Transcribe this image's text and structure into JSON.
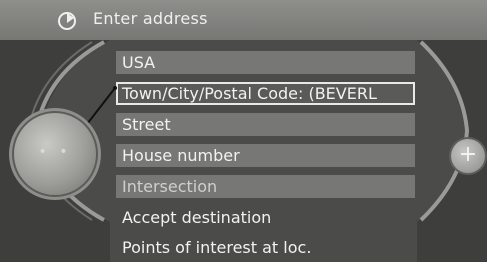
{
  "header": {
    "title": "Enter address",
    "icon": "navigation-flag-icon"
  },
  "menu": {
    "items": [
      {
        "label": "USA",
        "style": "boxed"
      },
      {
        "label": "Town/City/Postal Code: (BEVERL",
        "style": "selected"
      },
      {
        "label": "Street",
        "style": "boxed"
      },
      {
        "label": "House number",
        "style": "boxed"
      },
      {
        "label": "Intersection",
        "style": "boxed"
      },
      {
        "label": "Accept destination",
        "style": "plain"
      },
      {
        "label": "Points of interest at loc.",
        "style": "plain"
      }
    ]
  },
  "controller": {
    "knob_icon": "controller-knob-icon",
    "knob_label": "• •",
    "side_button_label": "+"
  },
  "colors": {
    "background": "#4b4b49",
    "item_fill": "#777775",
    "highlight_border": "#e9e9e6",
    "text": "#f2f2f0"
  }
}
